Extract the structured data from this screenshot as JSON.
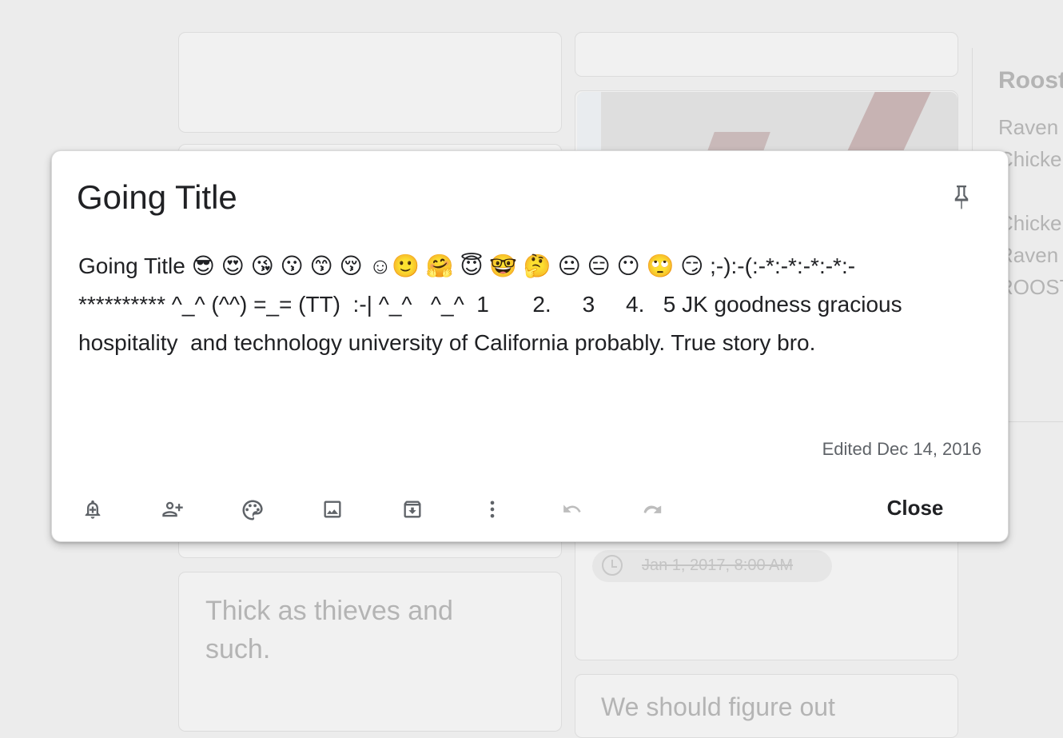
{
  "background": {
    "card_left_bottom_text": "Thick as thieves and such.",
    "card_right_bottom_text": "We should figure out",
    "reminder_chip": "Jan 1, 2017, 8:00 AM",
    "side_list": {
      "title": "Roost",
      "lines": [
        "Raven",
        "Chicke",
        "Chicke",
        "Raven",
        "ROOST"
      ]
    }
  },
  "note": {
    "title": "Going Title",
    "body": "Going Title 😎 😍 😘 😗 😙 😚 ☺🙂 🤗 😇 🤓 🤔 😐 😑 😶 🙄 😏 ;-):-(:-*:-*:-*:-*:-\n********** ^_^ (^^) =_= (TT)  :-| ^_^   ^_^  1       2.     3     4.   5 JK goodness gracious hospitality  and technology university of California probably. True story bro.",
    "edited": "Edited Dec 14, 2016",
    "pin_icon": "pin-icon"
  },
  "toolbar": {
    "icons": [
      "reminder-icon",
      "collaborator-icon",
      "palette-icon",
      "image-icon",
      "archive-icon",
      "more-icon",
      "undo-icon",
      "redo-icon"
    ],
    "close_label": "Close"
  },
  "colors": {
    "modal_bg": "#ffffff",
    "text": "#202124",
    "muted": "#5f6368",
    "disabled_icon": "#bdbdbd",
    "backdrop": "#ececec"
  }
}
